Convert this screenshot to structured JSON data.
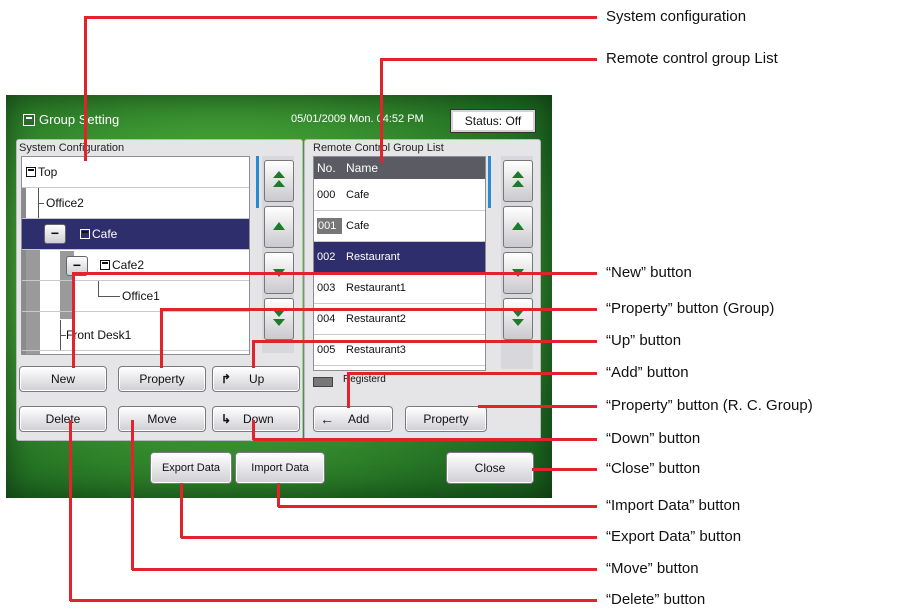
{
  "window": {
    "title": "Group Setting",
    "datetime": "05/01/2009 Mon. 04:52 PM",
    "status": "Status: Off"
  },
  "system_configuration": {
    "label": "System Configuration",
    "tree": [
      "Top",
      "Office2",
      "Cafe",
      "Cafe2",
      "Office1",
      "Front Desk1"
    ],
    "buttons": {
      "new": "New",
      "property": "Property",
      "up": "Up",
      "delete": "Delete",
      "move": "Move",
      "down": "Down"
    }
  },
  "remote_control_group_list": {
    "label": "Remote Control Group List",
    "col_no": "No.",
    "col_name": "Name",
    "rows": [
      {
        "no": "000",
        "name": "Cafe"
      },
      {
        "no": "001",
        "name": "Cafe"
      },
      {
        "no": "002",
        "name": "Restaurant"
      },
      {
        "no": "003",
        "name": "Restaurant1"
      },
      {
        "no": "004",
        "name": "Restaurant2"
      },
      {
        "no": "005",
        "name": "Restaurant3"
      }
    ],
    "legend": "Registerd",
    "buttons": {
      "add": "Add",
      "property": "Property"
    }
  },
  "bottom_buttons": {
    "export": "Export Data",
    "import": "Import Data",
    "close": "Close"
  },
  "annotations": [
    "System configuration",
    "Remote control group List",
    "“New” button",
    "“Property” button (Group)",
    "“Up” button",
    "“Add” button",
    "“Property” button (R. C. Group)",
    "“Down” button",
    "“Close” button",
    "“Import Data” button",
    "“Export Data” button",
    "“Move” button",
    "“Delete” button"
  ],
  "colors": {
    "annotation_line": "#e3232c",
    "selection": "#2d2e6b",
    "panel": "#3f9a33"
  }
}
